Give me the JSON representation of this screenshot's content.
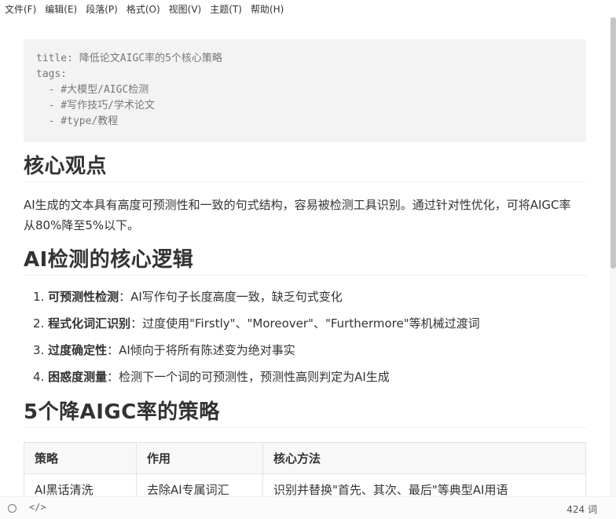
{
  "menu": {
    "items": [
      "文件(F)",
      "编辑(E)",
      "段落(P)",
      "格式(O)",
      "视图(V)",
      "主题(T)",
      "帮助(H)"
    ]
  },
  "frontmatter": {
    "lines": [
      "title: 降低论文AIGC率的5个核心策略",
      "tags:",
      "  - #大模型/AIGC检测",
      "  - #写作技巧/学术论文",
      "  - #type/教程"
    ]
  },
  "sections": {
    "h1_core": "核心观点",
    "core_para": "AI生成的文本具有高度可预测性和一致的句式结构，容易被检测工具识别。通过针对性优化，可将AIGC率从80%降至5%以下。",
    "h1_logic": "AI检测的核心逻辑",
    "logic_list": [
      {
        "num": "1.",
        "bold": "可预测性检测",
        "rest": "：AI写作句子长度高度一致，缺乏句式变化"
      },
      {
        "num": "2.",
        "bold": "程式化词汇识别",
        "rest": "：过度使用\"Firstly\"、\"Moreover\"、\"Furthermore\"等机械过渡词"
      },
      {
        "num": "3.",
        "bold": "过度确定性",
        "rest": "：AI倾向于将所有陈述变为绝对事实"
      },
      {
        "num": "4.",
        "bold": "困惑度测量",
        "rest": "：检测下一个词的可预测性，预测性高则判定为AI生成"
      }
    ],
    "h1_strategy": "5个降AIGC率的策略"
  },
  "table": {
    "headers": [
      "策略",
      "作用",
      "核心方法"
    ],
    "rows": [
      [
        "AI黑话清洗",
        "去除AI专属词汇",
        "识别并替换\"首先、其次、最后\"等典型AI用语"
      ]
    ]
  },
  "status": {
    "code_icon": "</>",
    "word_count": "424 词"
  }
}
